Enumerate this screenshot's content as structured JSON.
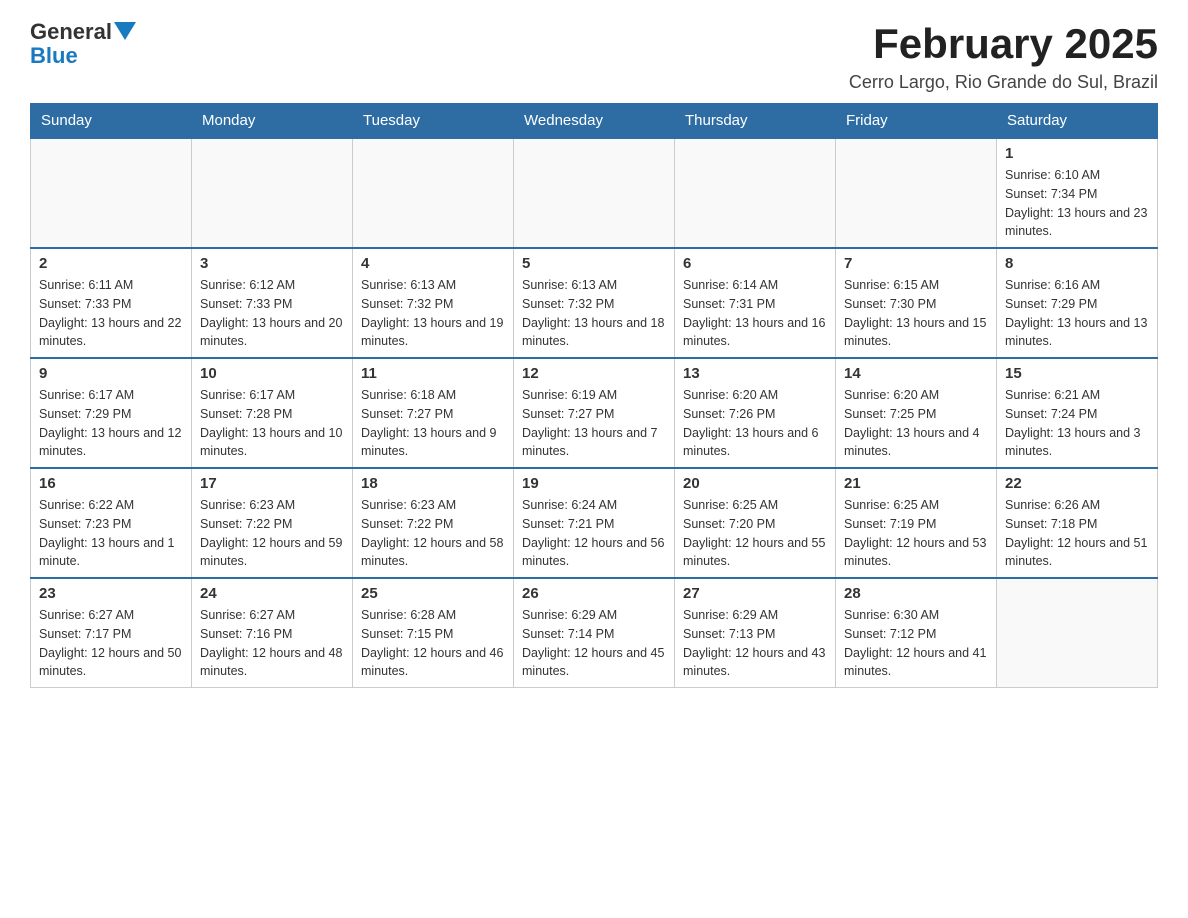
{
  "header": {
    "logo_general": "General",
    "logo_blue": "Blue",
    "month_title": "February 2025",
    "location": "Cerro Largo, Rio Grande do Sul, Brazil"
  },
  "days_of_week": [
    "Sunday",
    "Monday",
    "Tuesday",
    "Wednesday",
    "Thursday",
    "Friday",
    "Saturday"
  ],
  "weeks": [
    [
      {
        "day": "",
        "sunrise": "",
        "sunset": "",
        "daylight": ""
      },
      {
        "day": "",
        "sunrise": "",
        "sunset": "",
        "daylight": ""
      },
      {
        "day": "",
        "sunrise": "",
        "sunset": "",
        "daylight": ""
      },
      {
        "day": "",
        "sunrise": "",
        "sunset": "",
        "daylight": ""
      },
      {
        "day": "",
        "sunrise": "",
        "sunset": "",
        "daylight": ""
      },
      {
        "day": "",
        "sunrise": "",
        "sunset": "",
        "daylight": ""
      },
      {
        "day": "1",
        "sunrise": "Sunrise: 6:10 AM",
        "sunset": "Sunset: 7:34 PM",
        "daylight": "Daylight: 13 hours and 23 minutes."
      }
    ],
    [
      {
        "day": "2",
        "sunrise": "Sunrise: 6:11 AM",
        "sunset": "Sunset: 7:33 PM",
        "daylight": "Daylight: 13 hours and 22 minutes."
      },
      {
        "day": "3",
        "sunrise": "Sunrise: 6:12 AM",
        "sunset": "Sunset: 7:33 PM",
        "daylight": "Daylight: 13 hours and 20 minutes."
      },
      {
        "day": "4",
        "sunrise": "Sunrise: 6:13 AM",
        "sunset": "Sunset: 7:32 PM",
        "daylight": "Daylight: 13 hours and 19 minutes."
      },
      {
        "day": "5",
        "sunrise": "Sunrise: 6:13 AM",
        "sunset": "Sunset: 7:32 PM",
        "daylight": "Daylight: 13 hours and 18 minutes."
      },
      {
        "day": "6",
        "sunrise": "Sunrise: 6:14 AM",
        "sunset": "Sunset: 7:31 PM",
        "daylight": "Daylight: 13 hours and 16 minutes."
      },
      {
        "day": "7",
        "sunrise": "Sunrise: 6:15 AM",
        "sunset": "Sunset: 7:30 PM",
        "daylight": "Daylight: 13 hours and 15 minutes."
      },
      {
        "day": "8",
        "sunrise": "Sunrise: 6:16 AM",
        "sunset": "Sunset: 7:29 PM",
        "daylight": "Daylight: 13 hours and 13 minutes."
      }
    ],
    [
      {
        "day": "9",
        "sunrise": "Sunrise: 6:17 AM",
        "sunset": "Sunset: 7:29 PM",
        "daylight": "Daylight: 13 hours and 12 minutes."
      },
      {
        "day": "10",
        "sunrise": "Sunrise: 6:17 AM",
        "sunset": "Sunset: 7:28 PM",
        "daylight": "Daylight: 13 hours and 10 minutes."
      },
      {
        "day": "11",
        "sunrise": "Sunrise: 6:18 AM",
        "sunset": "Sunset: 7:27 PM",
        "daylight": "Daylight: 13 hours and 9 minutes."
      },
      {
        "day": "12",
        "sunrise": "Sunrise: 6:19 AM",
        "sunset": "Sunset: 7:27 PM",
        "daylight": "Daylight: 13 hours and 7 minutes."
      },
      {
        "day": "13",
        "sunrise": "Sunrise: 6:20 AM",
        "sunset": "Sunset: 7:26 PM",
        "daylight": "Daylight: 13 hours and 6 minutes."
      },
      {
        "day": "14",
        "sunrise": "Sunrise: 6:20 AM",
        "sunset": "Sunset: 7:25 PM",
        "daylight": "Daylight: 13 hours and 4 minutes."
      },
      {
        "day": "15",
        "sunrise": "Sunrise: 6:21 AM",
        "sunset": "Sunset: 7:24 PM",
        "daylight": "Daylight: 13 hours and 3 minutes."
      }
    ],
    [
      {
        "day": "16",
        "sunrise": "Sunrise: 6:22 AM",
        "sunset": "Sunset: 7:23 PM",
        "daylight": "Daylight: 13 hours and 1 minute."
      },
      {
        "day": "17",
        "sunrise": "Sunrise: 6:23 AM",
        "sunset": "Sunset: 7:22 PM",
        "daylight": "Daylight: 12 hours and 59 minutes."
      },
      {
        "day": "18",
        "sunrise": "Sunrise: 6:23 AM",
        "sunset": "Sunset: 7:22 PM",
        "daylight": "Daylight: 12 hours and 58 minutes."
      },
      {
        "day": "19",
        "sunrise": "Sunrise: 6:24 AM",
        "sunset": "Sunset: 7:21 PM",
        "daylight": "Daylight: 12 hours and 56 minutes."
      },
      {
        "day": "20",
        "sunrise": "Sunrise: 6:25 AM",
        "sunset": "Sunset: 7:20 PM",
        "daylight": "Daylight: 12 hours and 55 minutes."
      },
      {
        "day": "21",
        "sunrise": "Sunrise: 6:25 AM",
        "sunset": "Sunset: 7:19 PM",
        "daylight": "Daylight: 12 hours and 53 minutes."
      },
      {
        "day": "22",
        "sunrise": "Sunrise: 6:26 AM",
        "sunset": "Sunset: 7:18 PM",
        "daylight": "Daylight: 12 hours and 51 minutes."
      }
    ],
    [
      {
        "day": "23",
        "sunrise": "Sunrise: 6:27 AM",
        "sunset": "Sunset: 7:17 PM",
        "daylight": "Daylight: 12 hours and 50 minutes."
      },
      {
        "day": "24",
        "sunrise": "Sunrise: 6:27 AM",
        "sunset": "Sunset: 7:16 PM",
        "daylight": "Daylight: 12 hours and 48 minutes."
      },
      {
        "day": "25",
        "sunrise": "Sunrise: 6:28 AM",
        "sunset": "Sunset: 7:15 PM",
        "daylight": "Daylight: 12 hours and 46 minutes."
      },
      {
        "day": "26",
        "sunrise": "Sunrise: 6:29 AM",
        "sunset": "Sunset: 7:14 PM",
        "daylight": "Daylight: 12 hours and 45 minutes."
      },
      {
        "day": "27",
        "sunrise": "Sunrise: 6:29 AM",
        "sunset": "Sunset: 7:13 PM",
        "daylight": "Daylight: 12 hours and 43 minutes."
      },
      {
        "day": "28",
        "sunrise": "Sunrise: 6:30 AM",
        "sunset": "Sunset: 7:12 PM",
        "daylight": "Daylight: 12 hours and 41 minutes."
      },
      {
        "day": "",
        "sunrise": "",
        "sunset": "",
        "daylight": ""
      }
    ]
  ]
}
